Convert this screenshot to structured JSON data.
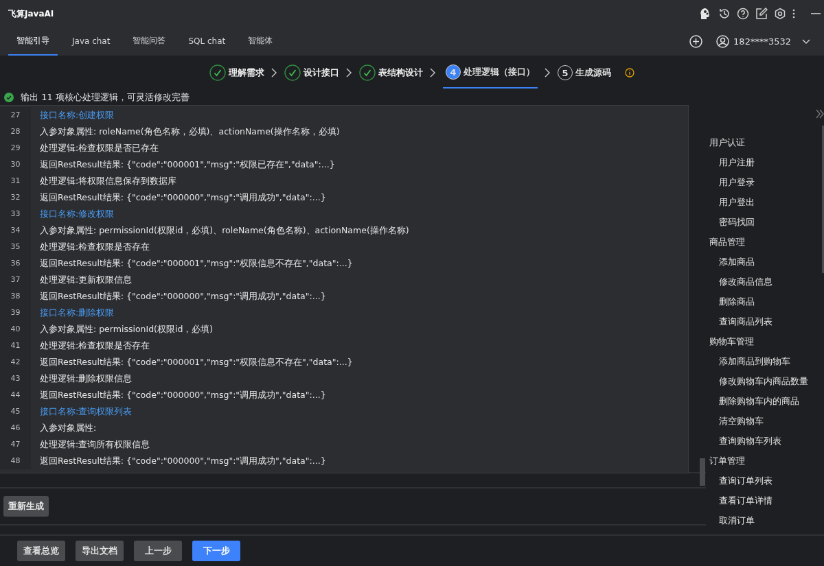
{
  "app_title": "飞算JavaAI",
  "tabs": [
    {
      "label": "智能引导",
      "selected": true
    },
    {
      "label": "Java chat",
      "selected": false
    },
    {
      "label": "智能问答",
      "selected": false
    },
    {
      "label": "SQL chat",
      "selected": false
    },
    {
      "label": "智能体",
      "selected": false
    }
  ],
  "account": "182****3532",
  "steps": [
    {
      "label": "理解需求",
      "done": true,
      "selected": false
    },
    {
      "label": "设计接口",
      "done": true,
      "selected": false
    },
    {
      "label": "表结构设计",
      "done": true,
      "selected": false
    },
    {
      "number": "4",
      "label": "处理逻辑（接口）",
      "done": false,
      "selected": true
    },
    {
      "number": "5",
      "label": "生成源码",
      "done": false,
      "selected": false
    }
  ],
  "status_message": "输出 11 项核心处理逻辑，可灵活修改完善",
  "lines": [
    {
      "number": "27",
      "kind": "title",
      "text": "接口名称:创建权限"
    },
    {
      "number": "28",
      "kind": "text",
      "text": "入参对象属性: roleName(角色名称，必填)、actionName(操作名称，必填)"
    },
    {
      "number": "29",
      "kind": "text",
      "text": "处理逻辑:检查权限是否已存在"
    },
    {
      "number": "30",
      "kind": "text",
      "text": "返回RestResult结果: {\"code\":\"000001\",\"msg\":\"权限已存在\",\"data\":...}"
    },
    {
      "number": "31",
      "kind": "text",
      "text": "处理逻辑:将权限信息保存到数据库"
    },
    {
      "number": "32",
      "kind": "text",
      "text": "返回RestResult结果: {\"code\":\"000000\",\"msg\":\"调用成功\",\"data\":...}"
    },
    {
      "number": "33",
      "kind": "title",
      "text": "接口名称:修改权限"
    },
    {
      "number": "34",
      "kind": "text",
      "text": "入参对象属性: permissionId(权限id，必填)、roleName(角色名称)、actionName(操作名称)"
    },
    {
      "number": "35",
      "kind": "text",
      "text": "处理逻辑:检查权限是否存在"
    },
    {
      "number": "36",
      "kind": "text",
      "text": "返回RestResult结果: {\"code\":\"000001\",\"msg\":\"权限信息不存在\",\"data\":...}"
    },
    {
      "number": "37",
      "kind": "text",
      "text": "处理逻辑:更新权限信息"
    },
    {
      "number": "38",
      "kind": "text",
      "text": "返回RestResult结果: {\"code\":\"000000\",\"msg\":\"调用成功\",\"data\":...}"
    },
    {
      "number": "39",
      "kind": "title",
      "text": "接口名称:删除权限"
    },
    {
      "number": "40",
      "kind": "text",
      "text": "入参对象属性: permissionId(权限id，必填)"
    },
    {
      "number": "41",
      "kind": "text",
      "text": "处理逻辑:检查权限是否存在"
    },
    {
      "number": "42",
      "kind": "text",
      "text": "返回RestResult结果: {\"code\":\"000001\",\"msg\":\"权限信息不存在\",\"data\":...}"
    },
    {
      "number": "43",
      "kind": "text",
      "text": "处理逻辑:删除权限信息"
    },
    {
      "number": "44",
      "kind": "text",
      "text": "返回RestResult结果: {\"code\":\"000000\",\"msg\":\"调用成功\",\"data\":...}"
    },
    {
      "number": "45",
      "kind": "title",
      "text": "接口名称:查询权限列表"
    },
    {
      "number": "46",
      "kind": "text",
      "text": "入参对象属性:"
    },
    {
      "number": "47",
      "kind": "text",
      "text": "处理逻辑:查询所有权限信息"
    },
    {
      "number": "48",
      "kind": "text",
      "text": "返回RestResult结果: {\"code\":\"000000\",\"msg\":\"调用成功\",\"data\":...}"
    }
  ],
  "outline": [
    {
      "label": "用户认证",
      "children": [
        {
          "label": "用户注册"
        },
        {
          "label": "用户登录"
        },
        {
          "label": "用户登出"
        },
        {
          "label": "密码找回"
        }
      ]
    },
    {
      "label": "商品管理",
      "children": [
        {
          "label": "添加商品"
        },
        {
          "label": "修改商品信息"
        },
        {
          "label": "删除商品"
        },
        {
          "label": "查询商品列表"
        }
      ]
    },
    {
      "label": "购物车管理",
      "children": [
        {
          "label": "添加商品到购物车"
        },
        {
          "label": "修改购物车内商品数量"
        },
        {
          "label": "删除购物车内的商品"
        },
        {
          "label": "清空购物车"
        },
        {
          "label": "查询购物车列表"
        }
      ]
    },
    {
      "label": "订单管理",
      "children": [
        {
          "label": "查询订单列表"
        },
        {
          "label": "查看订单详情"
        },
        {
          "label": "取消订单"
        }
      ]
    }
  ],
  "regenerate_button": "重新生成",
  "footer_buttons": [
    {
      "label": "查看总览",
      "kind": "secondary"
    },
    {
      "label": "导出文档",
      "kind": "secondary"
    },
    {
      "label": "上一步",
      "kind": "secondary"
    },
    {
      "label": "下一步",
      "kind": "primary"
    }
  ]
}
